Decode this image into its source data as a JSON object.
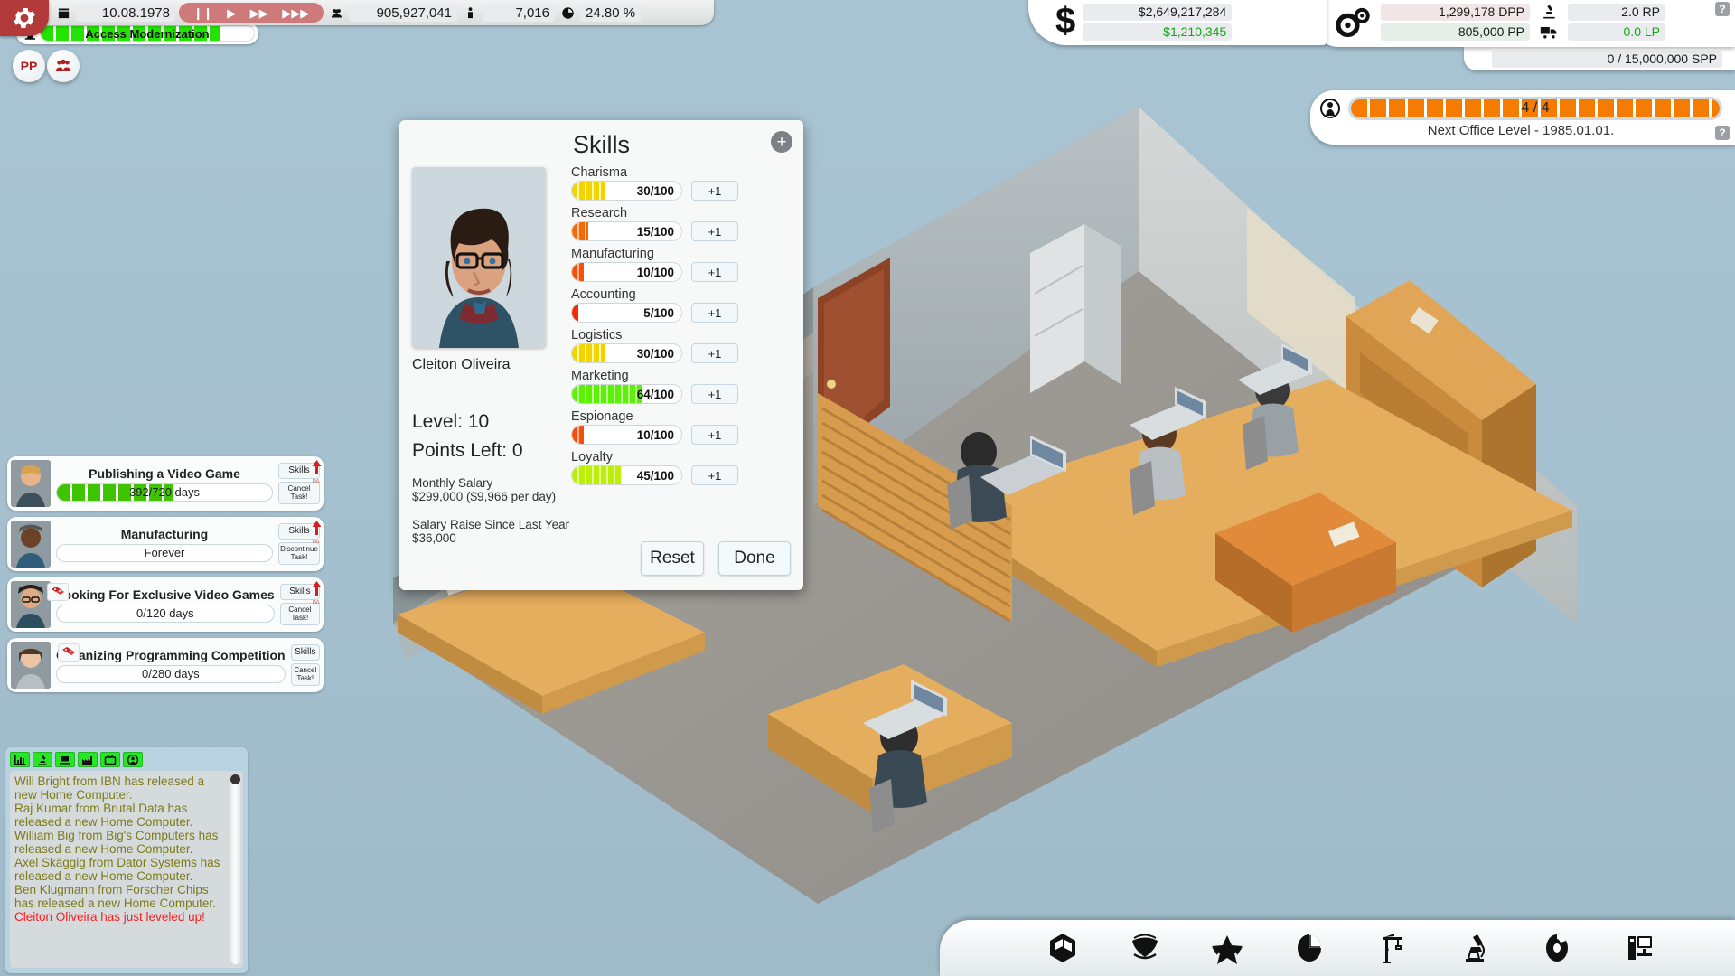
{
  "topbar": {
    "date": "10.08.1978",
    "fans": "905,927,041",
    "employees_or_units": "7,016",
    "market_share": "24.80 %",
    "speed_icons": [
      "pause",
      "play",
      "fast-forward",
      "very-fast-forward"
    ],
    "research_project": "Access Modernization",
    "research_progress_pct": 84,
    "pp_button": "PP",
    "people_button": "people-icon"
  },
  "money": {
    "balance": "$2,649,217,284",
    "income": "$1,210,345"
  },
  "production": {
    "dpp": "1,299,178 DPP",
    "pp": "805,000 PP",
    "rp": "2.0 RP",
    "lp": "0.0 LP",
    "spp": "0 / 15,000,000 SPP",
    "help": "?"
  },
  "office": {
    "level_text": "4 / 4",
    "next_level": "Next Office Level - 1985.01.01.",
    "fill_pct": 100,
    "help": "?"
  },
  "tasks": [
    {
      "title": "Publishing a Video Game",
      "progress_text": "392/720 days",
      "progress_pct": 54,
      "skills_label": "Skills",
      "cancel_label": "Cancel Task!",
      "has_dice": false,
      "has_lvl_arrow": true
    },
    {
      "title": "Manufacturing",
      "progress_text": "Forever",
      "progress_pct": 0,
      "skills_label": "Skills",
      "cancel_label": "Discontinue Task!",
      "has_dice": false,
      "has_lvl_arrow": true
    },
    {
      "title": "Looking For Exclusive Video Games",
      "progress_text": "0/120 days",
      "progress_pct": 0,
      "skills_label": "Skills",
      "cancel_label": "Cancel Task!",
      "has_dice": true,
      "has_lvl_arrow": true
    },
    {
      "title": "Organizing Programming Competition",
      "progress_text": "0/280 days",
      "progress_pct": 0,
      "skills_label": "Skills",
      "cancel_label": "Cancel Task!",
      "has_dice": true,
      "has_lvl_arrow": false
    }
  ],
  "news": {
    "tabs": [
      "chart-icon",
      "research-icon",
      "computer-icon",
      "factory-icon",
      "tv-icon",
      "person-icon"
    ],
    "lines": [
      {
        "text": "Will Bright from IBN has released a new Home Computer.",
        "color": "#7e7b17"
      },
      {
        "text": "Raj Kumar from Brutal Data has released a new Home Computer.",
        "color": "#7e7b17"
      },
      {
        "text": "William Big from Big's Computers has released a new Home Computer.",
        "color": "#7e7b17"
      },
      {
        "text": "Axel Skäggig from Dator Systems has released a new Home Computer.",
        "color": "#7e7b17"
      },
      {
        "text": "Ben Klugmann from Forscher Chips has released a new Home Computer.",
        "color": "#7e7b17"
      },
      {
        "text": "Cleiton Oliveira has just leveled up!",
        "color": "#ff1c1c"
      }
    ]
  },
  "dialog": {
    "title": "Skills",
    "plus_button": "+",
    "employee_name": "Cleiton Oliveira",
    "level": "Level: 10",
    "points_left": "Points Left: 0",
    "salary_label": "Monthly Salary",
    "salary_value": "$299,000 ($9,966 per day)",
    "raise_label": "Salary Raise Since Last Year",
    "raise_value": "$36,000",
    "reset_label": "Reset",
    "done_label": "Done",
    "plus_one_label": "+1",
    "skills": [
      {
        "name": "Charisma",
        "value": "30/100",
        "pct": 30,
        "color": "#f2d400"
      },
      {
        "name": "Research",
        "value": "15/100",
        "pct": 15,
        "color": "#f56b0a"
      },
      {
        "name": "Manufacturing",
        "value": "10/100",
        "pct": 10,
        "color": "#f5500a"
      },
      {
        "name": "Accounting",
        "value": "5/100",
        "pct": 5,
        "color": "#f52a0a"
      },
      {
        "name": "Logistics",
        "value": "30/100",
        "pct": 30,
        "color": "#f2d400"
      },
      {
        "name": "Marketing",
        "value": "64/100",
        "pct": 64,
        "color": "#5cf205"
      },
      {
        "name": "Espionage",
        "value": "10/100",
        "pct": 10,
        "color": "#f5500a"
      },
      {
        "name": "Loyalty",
        "value": "45/100",
        "pct": 45,
        "color": "#bdee05"
      }
    ]
  },
  "bottombar": {
    "icons": [
      "product-box-icon",
      "world-map-icon",
      "star-icon",
      "pie-chart-icon",
      "crane-icon",
      "microscope-icon",
      "disc-icon",
      "computer-icon"
    ]
  }
}
